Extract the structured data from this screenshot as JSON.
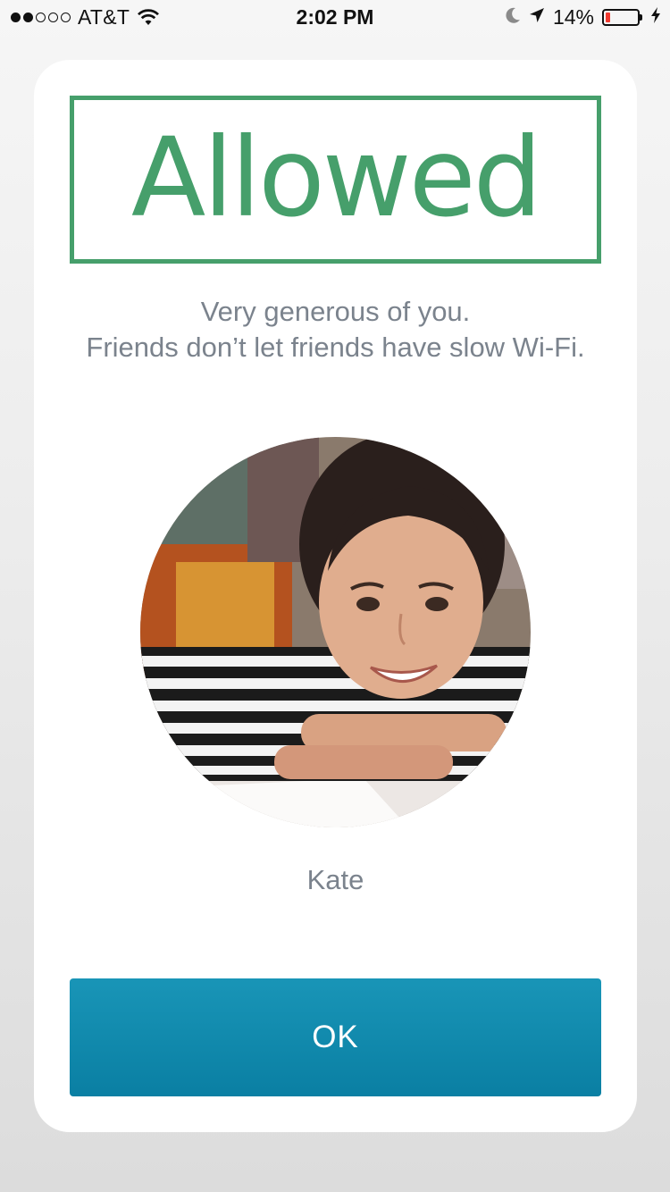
{
  "status_bar": {
    "carrier": "AT&T",
    "signal_bars_filled": 2,
    "signal_bars_total": 5,
    "time": "2:02 PM",
    "battery_percent": "14%",
    "battery_level": 0.14,
    "icons": [
      "wifi-icon",
      "moon-icon",
      "location-arrow-icon",
      "battery-icon",
      "charging-bolt-icon"
    ]
  },
  "result": {
    "stamp_label": "Allowed",
    "stamp_color": "#469f6b"
  },
  "message": {
    "line1": "Very generous of you.",
    "line2": "Friends don’t let friends have slow Wi-Fi."
  },
  "user": {
    "name": "Kate",
    "avatar_icon": "user-photo"
  },
  "actions": {
    "ok_label": "OK",
    "ok_color": "#1289ad"
  }
}
